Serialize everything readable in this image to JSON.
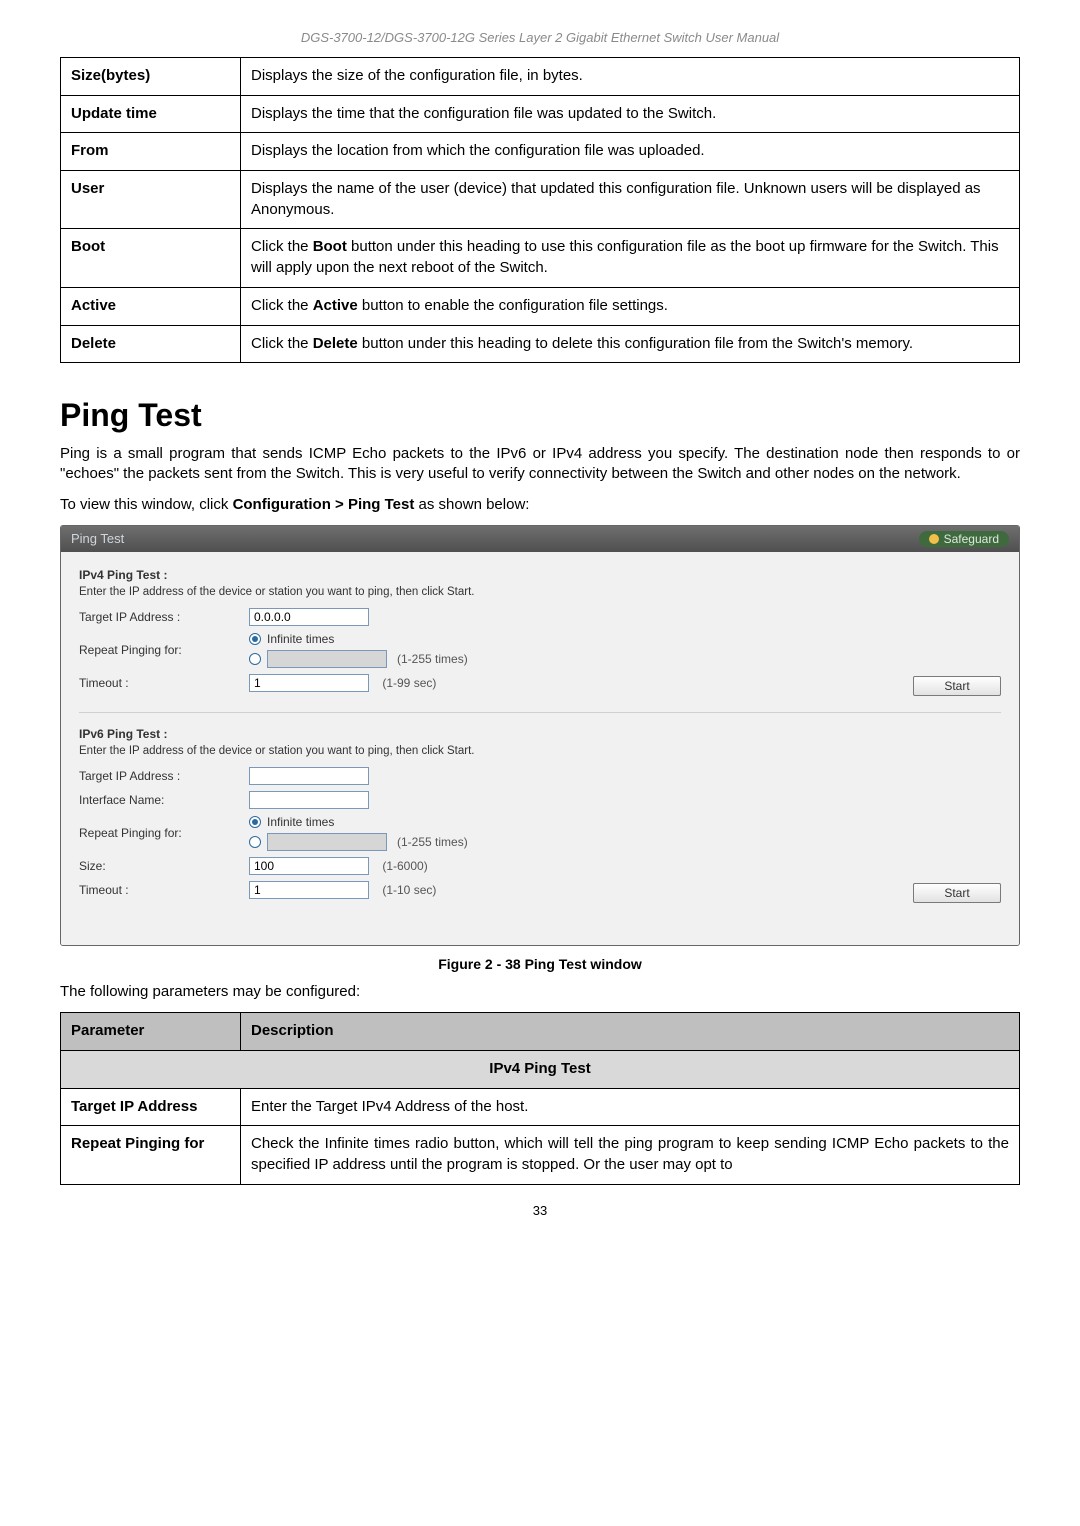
{
  "doc_header": "DGS-3700-12/DGS-3700-12G Series Layer 2 Gigabit Ethernet Switch User Manual",
  "table1": {
    "rows": [
      {
        "label": "Size(bytes)",
        "desc_parts": [
          "Displays the size of the configuration file, in bytes."
        ]
      },
      {
        "label": "Update time",
        "desc_parts": [
          "Displays the time that the configuration file was updated to the Switch."
        ]
      },
      {
        "label": "From",
        "desc_parts": [
          "Displays the location from which the configuration file was uploaded."
        ]
      },
      {
        "label": "User",
        "desc_parts": [
          "Displays the name of the user (device) that updated this configuration file. Unknown users will be displayed as Anonymous."
        ]
      },
      {
        "label": "Boot",
        "desc_parts": [
          "Click the ",
          {
            "bold": "Boot"
          },
          " button under this heading to use this configuration file as the boot up firmware for the Switch. This will apply upon the next reboot of the Switch."
        ]
      },
      {
        "label": "Active",
        "desc_parts": [
          "Click the ",
          {
            "bold": "Active"
          },
          " button to enable the configuration file settings."
        ]
      },
      {
        "label": "Delete",
        "desc_parts": [
          "Click the ",
          {
            "bold": "Delete"
          },
          " button under this heading to delete this configuration file from the Switch's memory."
        ],
        "justify": true
      }
    ]
  },
  "section_title": "Ping Test",
  "section_intro": "Ping is a small program that sends ICMP Echo packets to the IPv6 or IPv4 address you specify. The destination node then responds to or \"echoes\" the packets sent from the Switch. This is very useful to verify connectivity between the Switch and other nodes on the network.",
  "section_nav_pre": "To view this window, click ",
  "section_nav_bold": "Configuration > Ping Test",
  "section_nav_post": " as shown below:",
  "screenshot": {
    "title": "Ping Test",
    "safeguard": "Safeguard",
    "ipv4": {
      "heading": "IPv4 Ping Test :",
      "hint": "Enter the IP address of the device or station you want to ping, then click Start.",
      "target_label": "Target IP Address :",
      "target_value": "0.0.0.0",
      "repeat_label": "Repeat Pinging for:",
      "infinite_label": "Infinite times",
      "count_suffix": "(1-255 times)",
      "timeout_label": "Timeout :",
      "timeout_value": "1",
      "timeout_suffix": "(1-99 sec)",
      "start": "Start"
    },
    "ipv6": {
      "heading": "IPv6 Ping Test :",
      "hint": "Enter the IP address of the device or station you want to ping, then click Start.",
      "target_label": "Target IP Address :",
      "iface_label": "Interface Name:",
      "repeat_label": "Repeat Pinging for:",
      "infinite_label": "Infinite times",
      "count_suffix": "(1-255 times)",
      "size_label": "Size:",
      "size_value": "100",
      "size_suffix": "(1-6000)",
      "timeout_label": "Timeout :",
      "timeout_value": "1",
      "timeout_suffix": "(1-10 sec)",
      "start": "Start"
    }
  },
  "figure_caption": "Figure 2 - 38 Ping Test window",
  "params_intro": "The following parameters may be configured:",
  "params_header": {
    "param": "Parameter",
    "desc": "Description"
  },
  "params_subheader": "IPv4 Ping Test",
  "params_rows": [
    {
      "label": "Target IP Address",
      "desc": "Enter the Target IPv4 Address of the host."
    },
    {
      "label": "Repeat Pinging for",
      "desc": "Check the Infinite times radio button, which will tell the ping program to keep sending ICMP Echo packets to the specified IP address until the program is stopped. Or the user may opt to"
    }
  ],
  "page_number": "33"
}
